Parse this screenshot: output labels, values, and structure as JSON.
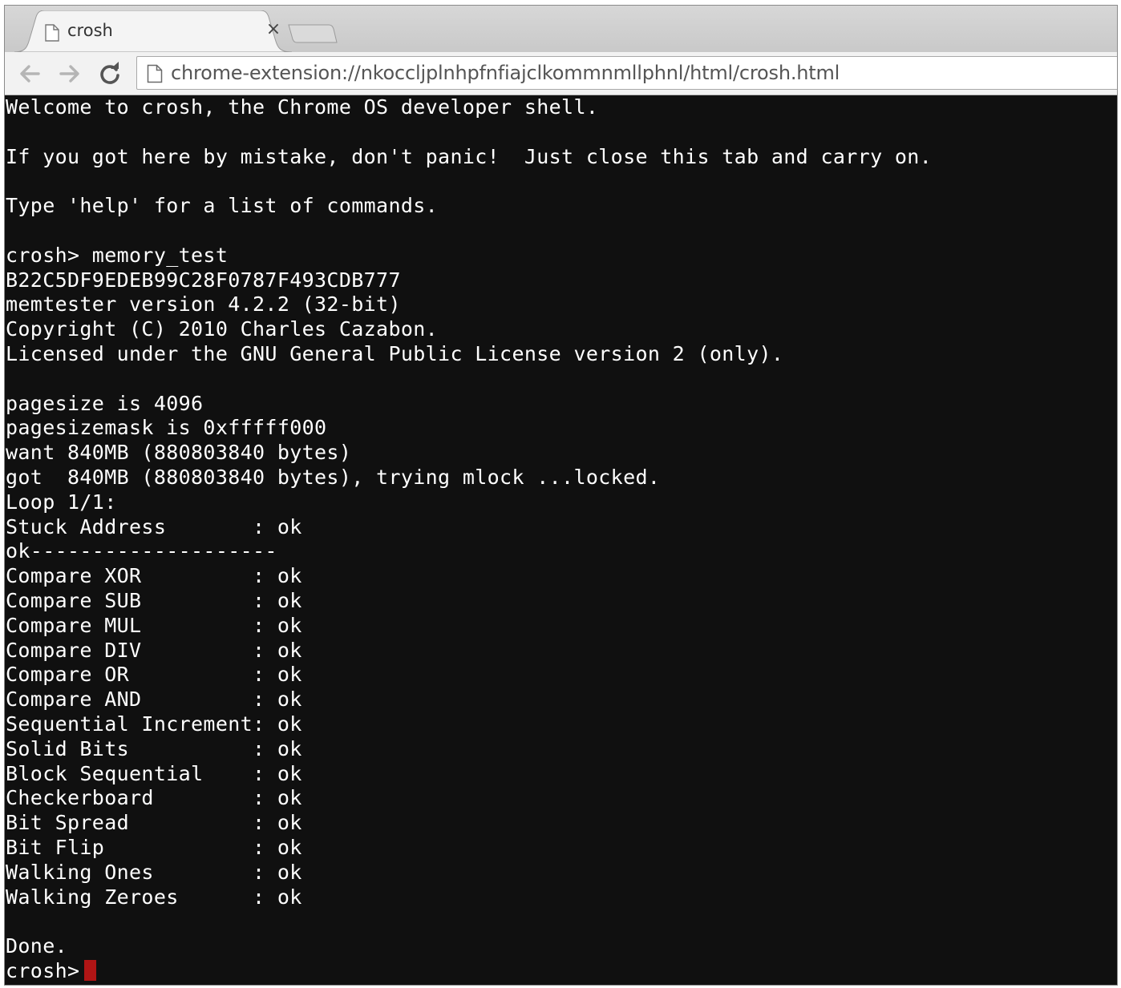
{
  "tab": {
    "title": "crosh",
    "close_glyph": "×",
    "favicon": "page-icon"
  },
  "toolbar": {
    "back_icon": "back-arrow-icon",
    "forward_icon": "forward-arrow-icon",
    "reload_icon": "reload-icon",
    "url": "chrome-extension://nkoccljplnhpfnfiajclkommnmllphnl/html/crosh.html"
  },
  "terminal": {
    "lines": [
      "Welcome to crosh, the Chrome OS developer shell.",
      "",
      "If you got here by mistake, don't panic!  Just close this tab and carry on.",
      "",
      "Type 'help' for a list of commands.",
      "",
      "crosh> memory_test",
      "B22C5DF9EDEB99C28F0787F493CDB777",
      "memtester version 4.2.2 (32-bit)",
      "Copyright (C) 2010 Charles Cazabon.",
      "Licensed under the GNU General Public License version 2 (only).",
      "",
      "pagesize is 4096",
      "pagesizemask is 0xfffff000",
      "want 840MB (880803840 bytes)",
      "got  840MB (880803840 bytes), trying mlock ...locked.",
      "Loop 1/1:",
      "Stuck Address       : ok",
      "ok--------------------",
      "Compare XOR         : ok",
      "Compare SUB         : ok",
      "Compare MUL         : ok",
      "Compare DIV         : ok",
      "Compare OR          : ok",
      "Compare AND         : ok",
      "Sequential Increment: ok",
      "Solid Bits          : ok",
      "Block Sequential    : ok",
      "Checkerboard        : ok",
      "Bit Spread          : ok",
      "Bit Flip            : ok",
      "Walking Ones        : ok",
      "Walking Zeroes      : ok",
      "",
      "Done."
    ],
    "prompt": "crosh>",
    "cursor_color": "#b01515",
    "background_color": "#101010",
    "text_color": "#ffffff"
  }
}
